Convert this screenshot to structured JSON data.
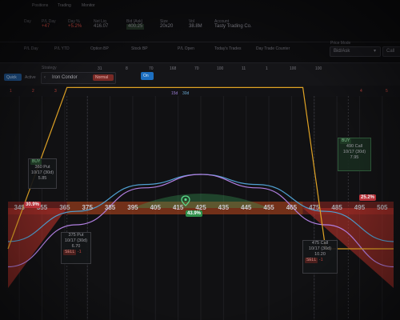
{
  "header": {
    "top_tabs": [
      "Positions",
      "Trading",
      "Monitor"
    ],
    "row1": [
      {
        "label": "Day",
        "value": ""
      },
      {
        "label": "P/L Day",
        "value": "+47"
      },
      {
        "label": "Day %",
        "value": "+5.2%"
      },
      {
        "label": "Net Liq",
        "value": "416.07"
      },
      {
        "label": "Bid (Ask)",
        "value": "400.25"
      },
      {
        "label": "Size",
        "value": "20x20"
      },
      {
        "label": "Vol",
        "value": "38.8M"
      },
      {
        "label": "Account",
        "value": "Tasty Trading Co."
      }
    ],
    "row2": [
      {
        "label": "P/L Day"
      },
      {
        "label": "P/L YTD"
      },
      {
        "label": "Option BP"
      },
      {
        "label": "Stock BP"
      },
      {
        "label": "P/L Open"
      },
      {
        "label": "Today's Trades"
      },
      {
        "label": "Day Trade Counter"
      }
    ],
    "price_mode_label": "Price Mode",
    "price_mode_value": "Bid/Ask",
    "call_label": "Call"
  },
  "strategy": {
    "label": "Strategy",
    "tabs": [
      "Quick",
      "Active"
    ],
    "name": "Iron Condor",
    "badge": "Normal",
    "toggle": "On",
    "counts": [
      "31",
      "8",
      "70",
      "168",
      "70",
      "100",
      "11",
      "1",
      "100",
      "100"
    ],
    "sub_values": [
      "1",
      "2",
      "3",
      "4",
      "5"
    ],
    "time_labels": [
      "15d",
      "30d"
    ]
  },
  "chart_data": {
    "type": "line",
    "title": "",
    "xlabel": "",
    "ylabel": "",
    "x_ticks": [
      345,
      355,
      365,
      375,
      385,
      395,
      405,
      415,
      425,
      435,
      445,
      455,
      465,
      475,
      485,
      495,
      505
    ],
    "xlim": [
      340,
      510
    ],
    "series": [
      {
        "name": "15d",
        "x": [
          340,
          370,
          400,
          425,
          450,
          480,
          510
        ],
        "y": [
          -35,
          -10,
          12,
          20,
          12,
          -10,
          -35
        ]
      },
      {
        "name": "30d",
        "x": [
          340,
          370,
          400,
          425,
          450,
          480,
          510
        ],
        "y": [
          -20,
          -2,
          14,
          20,
          14,
          -2,
          -20
        ]
      },
      {
        "name": "expiration",
        "x": [
          340,
          366,
          375,
          470,
          480,
          510
        ],
        "y": [
          -60,
          36,
          36,
          36,
          -60,
          -60
        ]
      }
    ],
    "breakevens_pct": [
      "30.9%",
      "25.2%"
    ],
    "profit_zone_pct": "43.9%",
    "current_price": 425
  },
  "legs": [
    {
      "action": "BUY",
      "qty": "+1",
      "strike": "360 Put",
      "expiry": "10/17 (30d)",
      "price": "5.85"
    },
    {
      "action": "SELL",
      "qty": "-1",
      "strike": "375 Put",
      "expiry": "10/17 (30d)",
      "price": "6.70"
    },
    {
      "action": "SELL",
      "qty": "-1",
      "strike": "475 Call",
      "expiry": "10/17 (30d)",
      "price": "10.20"
    },
    {
      "action": "BUY",
      "qty": "+1",
      "strike": "490 Call",
      "expiry": "10/17 (30d)",
      "price": "7.95"
    }
  ],
  "colors": {
    "loss": "#c9342b",
    "profit": "#3aa05a",
    "expiration_line": "#e0a325",
    "curve_15d": "#b07fe0",
    "curve_30d": "#4f9fd0",
    "accent": "#1e7fd8"
  }
}
